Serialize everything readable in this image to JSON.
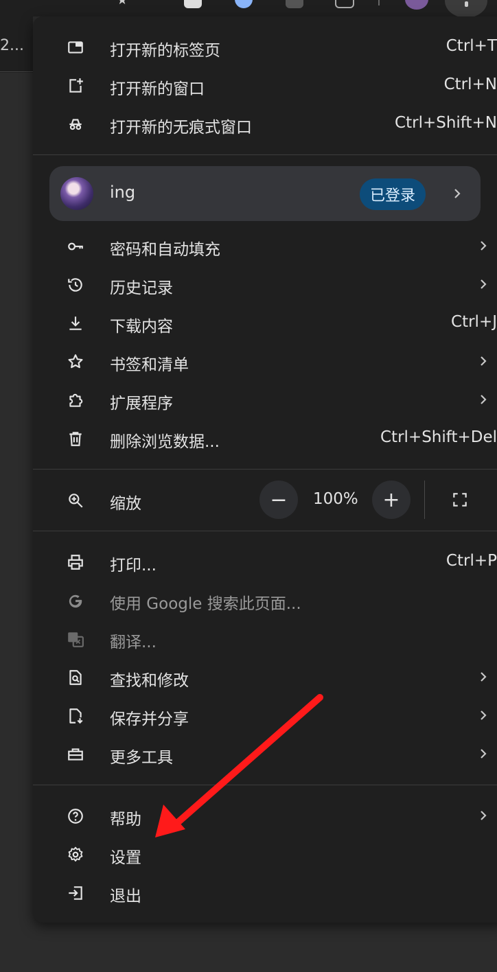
{
  "background_tab_text": "2...",
  "menu": {
    "new_tab": {
      "label": "打开新的标签页",
      "shortcut": "Ctrl+T"
    },
    "new_window": {
      "label": "打开新的窗口",
      "shortcut": "Ctrl+N"
    },
    "incognito": {
      "label": "打开新的无痕式窗口",
      "shortcut": "Ctrl+Shift+N"
    },
    "profile": {
      "name": "ing",
      "status": "已登录"
    },
    "passwords": {
      "label": "密码和自动填充"
    },
    "history": {
      "label": "历史记录"
    },
    "downloads": {
      "label": "下载内容",
      "shortcut": "Ctrl+J"
    },
    "bookmarks": {
      "label": "书签和清单"
    },
    "extensions": {
      "label": "扩展程序"
    },
    "clear_data": {
      "label": "删除浏览数据...",
      "shortcut": "Ctrl+Shift+Del"
    },
    "zoom": {
      "label": "缩放",
      "value": "100%",
      "minus": "−",
      "plus": "+"
    },
    "print": {
      "label": "打印...",
      "shortcut": "Ctrl+P"
    },
    "google_search": {
      "label": "使用 Google 搜索此页面..."
    },
    "translate": {
      "label": "翻译..."
    },
    "find_edit": {
      "label": "查找和修改"
    },
    "save_share": {
      "label": "保存并分享"
    },
    "more_tools": {
      "label": "更多工具"
    },
    "help": {
      "label": "帮助"
    },
    "settings": {
      "label": "设置"
    },
    "exit": {
      "label": "退出"
    }
  },
  "colors": {
    "menu_bg": "#1f1f1f",
    "profile_bg": "#35363a",
    "badge_bg": "#0d4c7a",
    "annotation_arrow": "#ff1a1a"
  }
}
